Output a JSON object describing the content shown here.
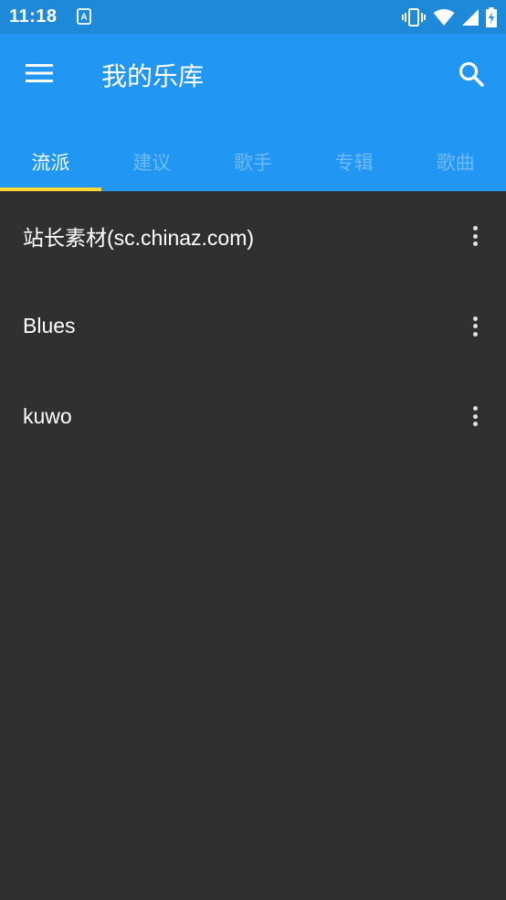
{
  "status_bar": {
    "time": "11:18",
    "app_icon": "accessibility-app-icon",
    "icons": [
      "vibrate-icon",
      "wifi-icon",
      "signal-icon",
      "battery-charging-icon"
    ]
  },
  "app_bar": {
    "title": "我的乐库",
    "menu_icon": "hamburger-menu-icon",
    "search_icon": "search-icon"
  },
  "tabs": [
    {
      "label": "流派",
      "active": true
    },
    {
      "label": "建议",
      "active": false
    },
    {
      "label": "歌手",
      "active": false
    },
    {
      "label": "专辑",
      "active": false
    },
    {
      "label": "歌曲",
      "active": false
    }
  ],
  "list": {
    "items": [
      {
        "label": "站长素材(sc.chinaz.com)"
      },
      {
        "label": "Blues"
      },
      {
        "label": "kuwo"
      }
    ],
    "overflow_icon": "more-vertical-icon"
  },
  "colors": {
    "status_bar": "#1e88d9",
    "app_bar": "#2196f3",
    "background": "#303030",
    "tab_indicator": "#fdd835"
  }
}
